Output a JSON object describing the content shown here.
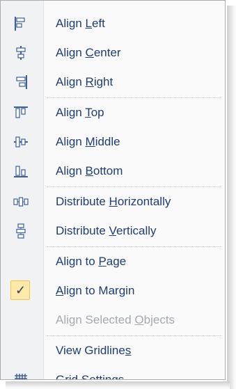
{
  "menu": {
    "items": [
      {
        "pre": "Align ",
        "key": "L",
        "post": "eft",
        "icon": "align-left-icon"
      },
      {
        "pre": "Align ",
        "key": "C",
        "post": "enter",
        "icon": "align-center-icon"
      },
      {
        "pre": "Align ",
        "key": "R",
        "post": "ight",
        "icon": "align-right-icon"
      },
      {
        "pre": "Align ",
        "key": "T",
        "post": "op",
        "icon": "align-top-icon"
      },
      {
        "pre": "Align ",
        "key": "M",
        "post": "iddle",
        "icon": "align-middle-icon"
      },
      {
        "pre": "Align ",
        "key": "B",
        "post": "ottom",
        "icon": "align-bottom-icon"
      },
      {
        "pre": "Distribute ",
        "key": "H",
        "post": "orizontally",
        "icon": "distribute-horizontally-icon"
      },
      {
        "pre": "Distribute ",
        "key": "V",
        "post": "ertically",
        "icon": "distribute-vertically-icon"
      },
      {
        "pre": "Align to ",
        "key": "P",
        "post": "age",
        "icon": ""
      },
      {
        "pre": "",
        "key": "A",
        "post": "lign to Margin",
        "icon": "checkmark-icon",
        "checked": true,
        "check_glyph": "✓"
      },
      {
        "pre": "Align Selected ",
        "key": "O",
        "post": "bjects",
        "icon": "",
        "disabled": true
      },
      {
        "pre": "View Gridline",
        "key": "s",
        "post": "",
        "icon": ""
      },
      {
        "pre": "",
        "key": "G",
        "post": "rid Settings...",
        "icon": "grid-icon"
      }
    ]
  },
  "colors": {
    "label": "#1e3d73",
    "disabled_label": "#a4a9b0",
    "icon_blue": "#3b5f9e",
    "checked_fill": "#fde9a8",
    "checked_border": "#f1c24d"
  }
}
